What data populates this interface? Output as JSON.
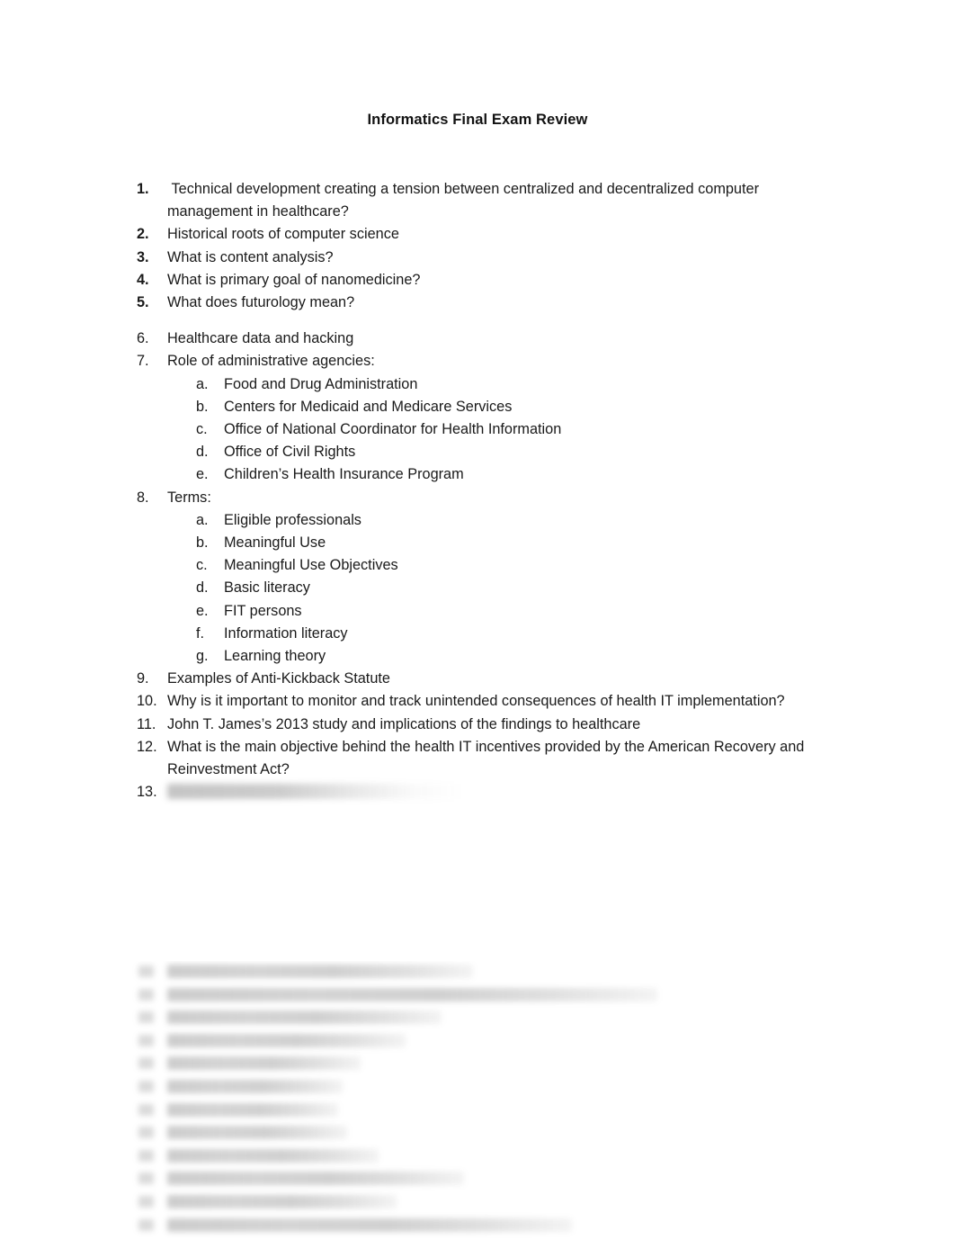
{
  "document": {
    "title": "Informatics Final Exam Review"
  },
  "outline": {
    "items": [
      {
        "number": "1.",
        "text": " Technical development creating a tension between centralized and decentralized computer management in healthcare?",
        "bold_number": true,
        "subitems": []
      },
      {
        "number": "2.",
        "text": "Historical roots of computer science",
        "bold_number": true,
        "subitems": []
      },
      {
        "number": "3.",
        "text": "What is content analysis?",
        "bold_number": true,
        "subitems": []
      },
      {
        "number": "4.",
        "text": "What is primary goal of nanomedicine?",
        "bold_number": true,
        "subitems": []
      },
      {
        "number": "5.",
        "text": "What does futurology mean?",
        "bold_number": true,
        "subitems": []
      },
      {
        "number": "6.",
        "text": "Healthcare data and hacking",
        "bold_number": false,
        "subitems": []
      },
      {
        "number": "7.",
        "text": "Role of administrative agencies:",
        "bold_number": false,
        "subitems": [
          {
            "letter": "a.",
            "text": "Food and Drug Administration"
          },
          {
            "letter": "b.",
            "text": "Centers for Medicaid and Medicare Services"
          },
          {
            "letter": "c.",
            "text": "Office of National Coordinator for Health Information"
          },
          {
            "letter": "d.",
            "text": "Office of Civil Rights"
          },
          {
            "letter": "e.",
            "text": "Children’s Health Insurance Program"
          }
        ]
      },
      {
        "number": "8.",
        "text": "Terms:",
        "bold_number": false,
        "subitems": [
          {
            "letter": "a.",
            "text": "Eligible professionals"
          },
          {
            "letter": "b.",
            "text": "Meaningful Use"
          },
          {
            "letter": "c.",
            "text": "Meaningful Use Objectives"
          },
          {
            "letter": "d.",
            "text": "Basic literacy"
          },
          {
            "letter": "e.",
            "text": "FIT persons"
          },
          {
            "letter": "f.",
            "text": "Information literacy"
          },
          {
            "letter": "g.",
            "text": "Learning theory"
          }
        ]
      },
      {
        "number": "9.",
        "text": "Examples of Anti-Kickback Statute",
        "bold_number": false,
        "subitems": []
      },
      {
        "number": "10.",
        "text": "Why is it important to monitor and track unintended consequences of health IT implementation?",
        "bold_number": false,
        "subitems": []
      },
      {
        "number": "11.",
        "text": "John T. James’s 2013 study and implications of the findings to healthcare",
        "bold_number": false,
        "subitems": []
      },
      {
        "number": "12.",
        "text": "What is the main objective behind the health IT incentives provided by the American Recovery and Reinvestment Act?",
        "bold_number": false,
        "subitems": []
      },
      {
        "number": "13.",
        "text": "",
        "bold_number": false,
        "redacted": true,
        "subitems": []
      }
    ]
  },
  "redacted_block": {
    "note": "illegible blurred text lines at bottom of page",
    "line_widths": [
      340,
      545,
      305,
      265,
      215,
      195,
      190,
      200,
      235,
      330,
      255,
      450
    ]
  }
}
